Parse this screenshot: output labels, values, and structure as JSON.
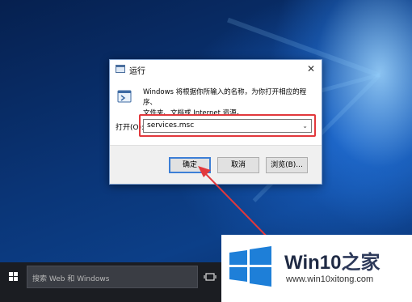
{
  "dialog": {
    "title": "运行",
    "description_line1": "Windows 将根据你所输入的名称，为你打开相应的程序、",
    "description_line2": "文件夹、文档或 Internet 资源。",
    "open_label": "打开(O):",
    "input_value": "services.msc",
    "ok_label": "确定",
    "cancel_label": "取消",
    "browse_label": "浏览(B)..."
  },
  "taskbar": {
    "search_placeholder": "搜索 Web 和 Windows"
  },
  "watermark": {
    "title_latin": "Win10",
    "title_zh": "之家",
    "url": "www.win10xitong.com"
  },
  "colors": {
    "highlight": "#e2383c",
    "accent": "#3c7fd6",
    "logo_blue": "#1e7fd8"
  }
}
